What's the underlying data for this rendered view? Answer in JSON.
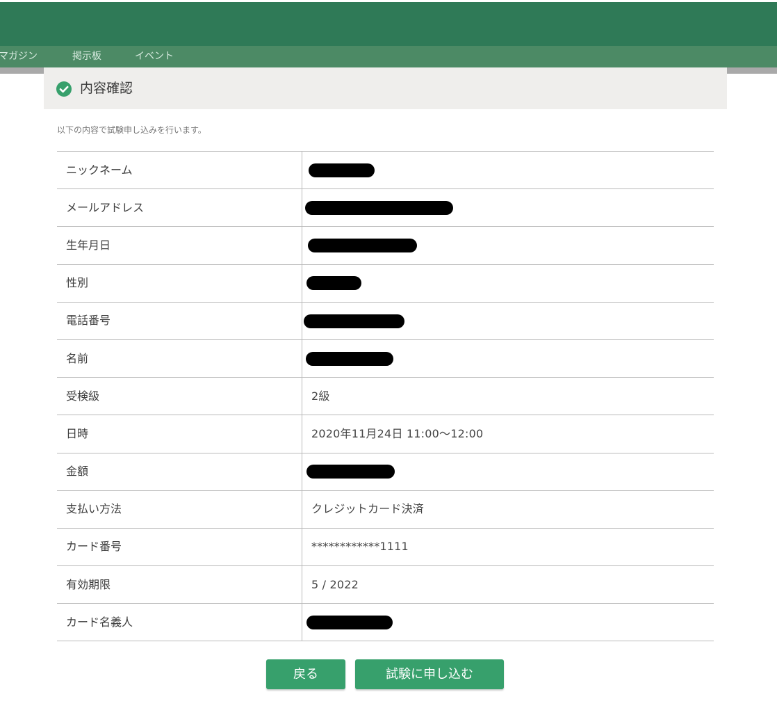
{
  "nav": {
    "items": [
      "マガジン",
      "掲示板",
      "イベント"
    ]
  },
  "section": {
    "title": "内容確認",
    "icon": "check-circle-icon",
    "accent_color": "#37a06c"
  },
  "intro_text": "以下の内容で試験申し込みを行います。",
  "rows": [
    {
      "label": "ニックネーム",
      "value": null,
      "redacted": true
    },
    {
      "label": "メールアドレス",
      "value": null,
      "redacted": true
    },
    {
      "label": "生年月日",
      "value": null,
      "redacted": true
    },
    {
      "label": "性別",
      "value": null,
      "redacted": true
    },
    {
      "label": "電話番号",
      "value": null,
      "redacted": true
    },
    {
      "label": "名前",
      "value": null,
      "redacted": true
    },
    {
      "label": "受検級",
      "value": "2級",
      "redacted": false
    },
    {
      "label": "日時",
      "value": "2020年11月24日 11:00～12:00",
      "redacted": false
    },
    {
      "label": "金額",
      "value": null,
      "redacted": true
    },
    {
      "label": "支払い方法",
      "value": "クレジットカード決済",
      "redacted": false
    },
    {
      "label": "カード番号",
      "value": "************1111",
      "redacted": false
    },
    {
      "label": "有効期限",
      "value": "5 / 2022",
      "redacted": false
    },
    {
      "label": "カード名義人",
      "value": null,
      "redacted": true
    }
  ],
  "buttons": {
    "back_label": "戻る",
    "submit_label": "試験に申し込む"
  }
}
